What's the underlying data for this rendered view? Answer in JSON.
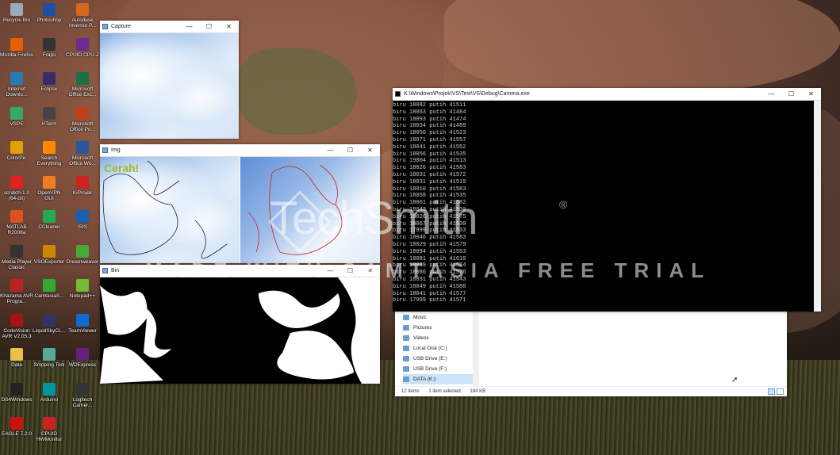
{
  "desktop_icons": [
    {
      "label": "Recycle Bin",
      "color": "#9ab"
    },
    {
      "label": "Photoshop",
      "color": "#1f4fa3"
    },
    {
      "label": "Autodesk Inventor P...",
      "color": "#d2691e"
    },
    {
      "label": "Mozilla Firefox",
      "color": "#e66000"
    },
    {
      "label": "Fraps",
      "color": "#333"
    },
    {
      "label": "CPUID CPU-Z",
      "color": "#6a2c91"
    },
    {
      "label": "Internet Downlo...",
      "color": "#2a7ab8"
    },
    {
      "label": "Eclipse",
      "color": "#3b2a6a"
    },
    {
      "label": "Microsoft Office Exc...",
      "color": "#1d7044"
    },
    {
      "label": "VSPE",
      "color": "#3a6"
    },
    {
      "label": "HTerm",
      "color": "#444"
    },
    {
      "label": "Microsoft Office Po...",
      "color": "#c43e1c"
    },
    {
      "label": "ColorPic",
      "color": "#e0a000"
    },
    {
      "label": "Search Everything",
      "color": "#f80"
    },
    {
      "label": "Microsoft Office Wo...",
      "color": "#2b579a"
    },
    {
      "label": "scratch-1.0 (64-bit)",
      "color": "#d22"
    },
    {
      "label": "OpenVPN GUI",
      "color": "#ea7e20"
    },
    {
      "label": "KiProjek",
      "color": "#c22"
    },
    {
      "label": "MATLAB R2008a",
      "color": "#d9531e"
    },
    {
      "label": "CCleaner",
      "color": "#2a5"
    },
    {
      "label": "ISIS",
      "color": "#1a5fb4"
    },
    {
      "label": "Media Player Classic",
      "color": "#333"
    },
    {
      "label": "VSOExporter",
      "color": "#c80"
    },
    {
      "label": "Dreamweaver",
      "color": "#4a3"
    },
    {
      "label": "Khazama AVR Progra...",
      "color": "#b22"
    },
    {
      "label": "CamtasiaS...",
      "color": "#3a3"
    },
    {
      "label": "Notepad++",
      "color": "#7b3"
    },
    {
      "label": "CodeVision AVR V2.05.3",
      "color": "#a11"
    },
    {
      "label": "LiquidSkyCL...",
      "color": "#336"
    },
    {
      "label": "TeamViewer",
      "color": "#0e6bd6"
    },
    {
      "label": "Data",
      "color": "#e8c04a"
    },
    {
      "label": "Snipping Tool",
      "color": "#5a9"
    },
    {
      "label": "WDExpress",
      "color": "#68217a"
    },
    {
      "label": "DS4Windows",
      "color": "#222"
    },
    {
      "label": "Arduino",
      "color": "#00979c"
    },
    {
      "label": "Logitech Camer...",
      "color": "#333"
    },
    {
      "label": "EAGLE 7.2.0",
      "color": "#c11"
    },
    {
      "label": "CPUID HWMonitor",
      "color": "#c22"
    }
  ],
  "capture_window": {
    "title": "Capture"
  },
  "img_window": {
    "title": "Img",
    "overlay_text": "Cerah!"
  },
  "bin_window": {
    "title": "Bin"
  },
  "console_window": {
    "title": "K:\\Windows\\Projek\\VS\\Test\\VS\\Debug\\Camera.exe",
    "lines": [
      "biru 18082 putih 41511",
      "biru 18063 putih 41484",
      "biru 18093 putih 41474",
      "biru 18034 putih 41489",
      "biru 18050 putih 41523",
      "biru 18071 putih 41557",
      "biru 18041 putih 41552",
      "biru 18056 putih 41535",
      "biru 19004 putih 41513",
      "biru 18026 putih 41583",
      "biru 18031 putih 41572",
      "biru 18031 putih 41519",
      "biru 18010 putih 41583",
      "biru 18058 putih 41535",
      "biru 18061 putih 41582",
      "biru 18043 putih 41530",
      "biru 18026 putih 41575",
      "biru 18067 putih 41530",
      "biru 17999 putih 41533",
      "biru 18046 putih 41583",
      "biru 18029 putih 41579",
      "biru 18094 putih 41553",
      "biru 18081 putih 41610",
      "biru 18039 putih 41574",
      "biru 18086 putih 41576",
      "biru 18031 putih 41543",
      "biru 18049 putih 41588",
      "biru 18041 putih 41577",
      "biru 17999 putih 41571"
    ]
  },
  "explorer": {
    "nav_items": [
      "Music",
      "Pictures",
      "Videos",
      "Local Disk (C:)",
      "USB Drive (E:)",
      "USB Drive (F:)",
      "DATA (K:)"
    ],
    "selected_index": 6,
    "status": {
      "items": "12 items",
      "selected": "1 item selected",
      "size": "184 KB"
    }
  },
  "watermark": {
    "logo": "TechSmith",
    "registered": "®",
    "banner": "MADE WITH CAMTASIA FREE TRIAL"
  },
  "window_controls": {
    "minimize": "—",
    "maximize": "☐",
    "close": "✕"
  }
}
